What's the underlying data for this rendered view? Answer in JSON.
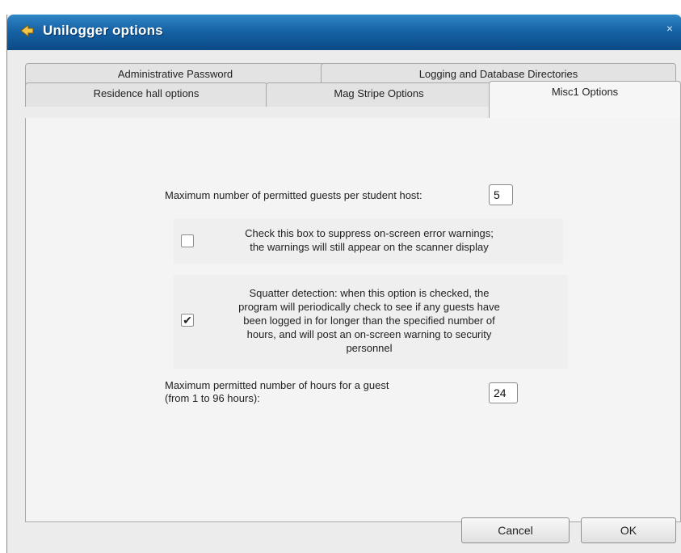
{
  "window": {
    "title": "Unilogger options",
    "close_glyph": "×"
  },
  "tabs_row1": [
    {
      "label": "Administrative Password"
    },
    {
      "label": "Logging and Database Directories"
    }
  ],
  "tabs_row2": [
    {
      "label": "Residence hall options"
    },
    {
      "label": "Mag Stripe Options"
    },
    {
      "label": "Misc1 Options",
      "active": true
    }
  ],
  "misc": {
    "max_guests_label": "Maximum number of permitted guests per student host:",
    "max_guests_value": "5",
    "suppress_line1": "Check this box to suppress on-screen error warnings;",
    "suppress_line2": "the warnings will still appear on the scanner display",
    "suppress_checked": false,
    "squatter_lines": [
      "Squatter detection: when this option is checked, the",
      "program will periodically check to see if any guests have",
      "been logged in for longer than the specified number of",
      "hours, and will post an on-screen warning to security",
      "personnel"
    ],
    "squatter_checked": true,
    "check_glyph": "✔",
    "max_hours_line1": "Maximum permitted number of hours for a guest",
    "max_hours_line2": "(from 1 to 96 hours):",
    "max_hours_value": "24"
  },
  "buttons": {
    "cancel": "Cancel",
    "ok": "OK"
  },
  "icons": {
    "app_icon": "arrow-icon",
    "close_icon": "close-icon"
  }
}
